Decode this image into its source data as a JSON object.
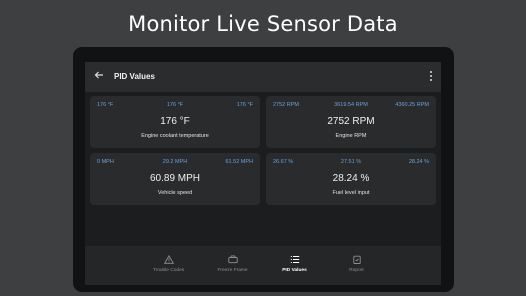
{
  "promo": {
    "title": "Monitor Live Sensor Data"
  },
  "appbar": {
    "title": "PID Values",
    "back_icon": "arrow-left-icon",
    "menu_icon": "more-vert-icon"
  },
  "cards": [
    {
      "min": "176 °F",
      "avg": "176 °F",
      "max": "176 °F",
      "value": "176 °F",
      "label": "Engine coolant temperature"
    },
    {
      "min": "2752 RPM",
      "avg": "3619.54 RPM",
      "max": "4360.25 RPM",
      "value": "2752 RPM",
      "label": "Engine RPM"
    },
    {
      "min": "0 MPH",
      "avg": "29.2 MPH",
      "max": "61.52 MPH",
      "value": "60.89 MPH",
      "label": "Vehicle speed"
    },
    {
      "min": "26.67 %",
      "avg": "27.51 %",
      "max": "28.24 %",
      "value": "28.24 %",
      "label": "Fuel level input"
    }
  ],
  "nav": [
    {
      "label": "Trouble Codes",
      "icon": "warning-icon"
    },
    {
      "label": "Freeze Frame",
      "icon": "car-icon"
    },
    {
      "label": "PID Values",
      "icon": "list-icon",
      "active": true
    },
    {
      "label": "Report",
      "icon": "clipboard-icon"
    }
  ],
  "colors": {
    "accent": "#6aa3d6",
    "background": "#3d3f41",
    "card": "#2a2b2d"
  }
}
